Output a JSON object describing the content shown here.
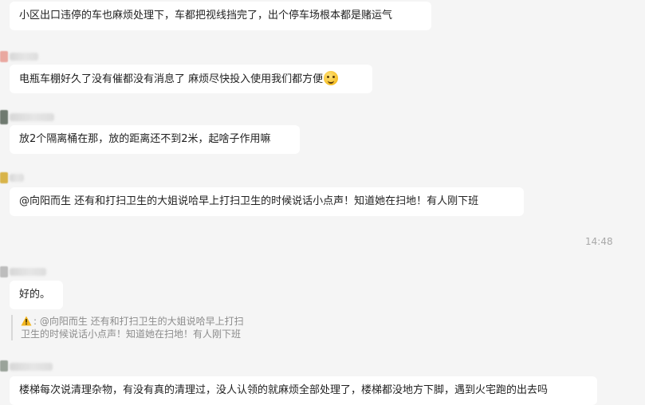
{
  "messages": [
    {
      "text": "小区出口违停的车也麻烦处理下，车都把视线挡完了，出个停车场根本都是赌运气"
    },
    {
      "text": "电瓶车棚好久了没有催都没有消息了 麻烦尽快投入使用我们都方便",
      "emoji": "smiling-face-emoji"
    },
    {
      "text": "放2个隔离桶在那，放的距离还不到2米，起啥子作用嘛"
    },
    {
      "text": "@向阳而生 还有和打扫卫生的大姐说哈早上打扫卫生的时候说话小点声！知道她在扫地！有人刚下班"
    },
    {
      "text": "好的。"
    },
    {
      "text": "楼梯每次说清理杂物，有没有真的清理过，没人认领的就麻烦全部处理了，楼梯都没地方下脚，遇到火宅跑的出去吗"
    }
  ],
  "timestamp": "14:48",
  "quote": {
    "icon": "warning-icon",
    "prefix": ": ",
    "line1": "@向阳而生 还有和打扫卫生的大姐说哈早上打扫",
    "line2": "卫生的时候说话小点声！知道她在扫地！有人刚下班"
  },
  "colors": {
    "background": "#f5f5f5",
    "bubble": "#ffffff",
    "timestamp": "#a8a8a8",
    "quote_text": "#8c8c8c"
  }
}
